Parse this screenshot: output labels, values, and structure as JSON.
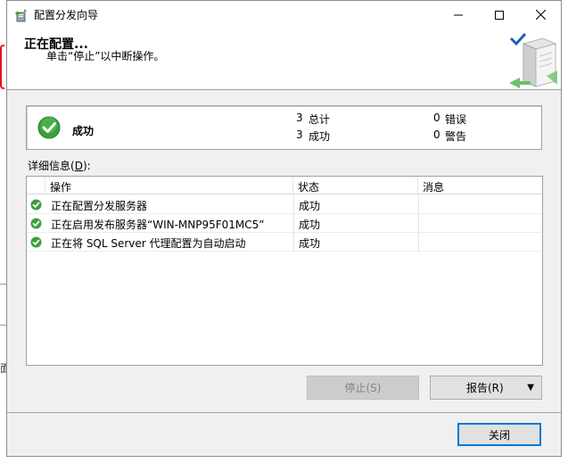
{
  "window": {
    "title": "配置分发向导",
    "minimize_glyph": "—",
    "maximize_glyph": "☐",
    "close_glyph": "✕"
  },
  "header": {
    "title": "正在配置...",
    "subtitle": "单击“停止”以中断操作。"
  },
  "status": {
    "label": "成功",
    "total_count": "3",
    "total_label": "总计",
    "success_count": "3",
    "success_label": "成功",
    "error_count": "0",
    "error_label": "错误",
    "warning_count": "0",
    "warning_label": "警告"
  },
  "details": {
    "label_prefix": "详细信息(",
    "label_key": "D",
    "label_suffix": "):",
    "columns": [
      "操作",
      "状态",
      "消息"
    ],
    "rows": [
      {
        "action": "正在配置分发服务器",
        "status": "成功",
        "message": ""
      },
      {
        "action": "正在启用发布服务器“WIN-MNP95F01MC5”",
        "status": "成功",
        "message": ""
      },
      {
        "action": "正在将 SQL Server 代理配置为自动启动",
        "status": "成功",
        "message": ""
      }
    ]
  },
  "buttons": {
    "stop": "停止(S)",
    "report": "报告(R)",
    "close": "关闭",
    "dropdown_glyph": "▼"
  },
  "background": {
    "partial_char": "面"
  },
  "colors": {
    "success_green": "#3aa13a",
    "close_focus": "#0078d7"
  }
}
